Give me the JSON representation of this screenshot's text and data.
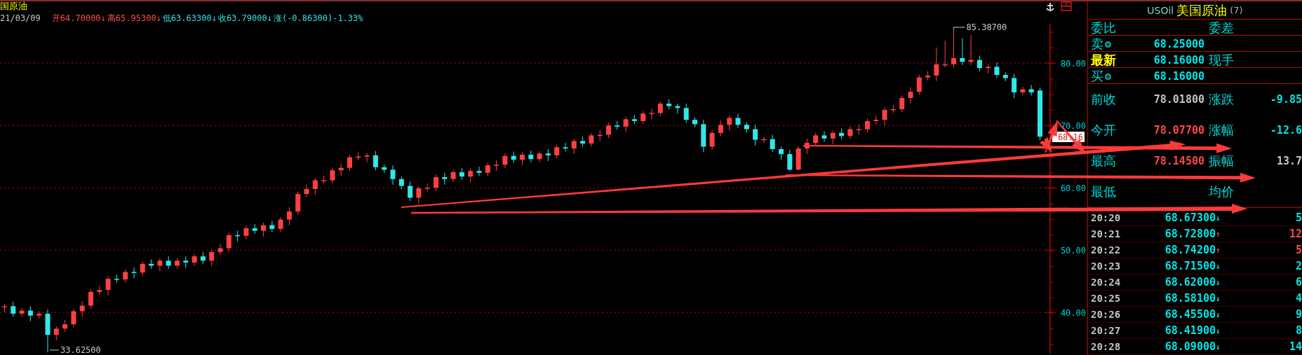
{
  "chart": {
    "title": "国原油",
    "date": "21/03/09",
    "quote": [
      {
        "text": "开64.70000↓",
        "color": "#ff4d4d"
      },
      {
        "text": "高65.95300↓",
        "color": "#ff4d4d"
      },
      {
        "text": "低63.63300↓",
        "color": "#33e0e0"
      },
      {
        "text": "收63.79000↓",
        "color": "#33e0e0"
      },
      {
        "text": "涨(-0.86300)-1.33%",
        "color": "#33e0e0"
      }
    ],
    "high_label": "85.38700",
    "low_label": "33.62500",
    "price_tag": "68.16",
    "chart_data": {
      "type": "candlestick",
      "grid": true,
      "ylim": [
        33.4,
        86.3
      ],
      "ohlc": [
        [
          40.9,
          41.4,
          40.0,
          41.0
        ],
        [
          41.0,
          41.7,
          39.3,
          39.8
        ],
        [
          39.8,
          40.7,
          39.3,
          40.3
        ],
        [
          40.3,
          41.0,
          38.6,
          39.5
        ],
        [
          39.5,
          40.2,
          39.0,
          39.8
        ],
        [
          39.8,
          40.5,
          33.6,
          36.4
        ],
        [
          36.4,
          37.8,
          35.5,
          37.4
        ],
        [
          37.4,
          38.8,
          36.9,
          38.1
        ],
        [
          38.1,
          40.6,
          37.6,
          40.2
        ],
        [
          40.2,
          41.8,
          39.3,
          41.1
        ],
        [
          41.1,
          43.7,
          40.6,
          43.3
        ],
        [
          43.3,
          44.3,
          42.8,
          43.6
        ],
        [
          43.6,
          45.8,
          42.7,
          45.4
        ],
        [
          45.4,
          46.1,
          44.8,
          45.3
        ],
        [
          45.3,
          46.9,
          44.8,
          46.5
        ],
        [
          46.5,
          47.2,
          45.5,
          46.4
        ],
        [
          46.4,
          48.2,
          45.9,
          47.8
        ],
        [
          47.8,
          48.5,
          47.0,
          47.5
        ],
        [
          47.5,
          48.7,
          46.6,
          48.3
        ],
        [
          48.3,
          49.0,
          47.0,
          47.5
        ],
        [
          47.5,
          48.7,
          47.0,
          48.3
        ],
        [
          48.3,
          49.0,
          47.1,
          48.0
        ],
        [
          48.0,
          49.4,
          47.5,
          49.0
        ],
        [
          49.0,
          49.7,
          47.8,
          48.3
        ],
        [
          48.3,
          50.1,
          47.4,
          49.7
        ],
        [
          49.7,
          51.0,
          49.2,
          50.3
        ],
        [
          50.3,
          52.8,
          49.8,
          52.4
        ],
        [
          52.4,
          53.1,
          51.4,
          52.3
        ],
        [
          52.3,
          53.9,
          51.8,
          53.5
        ],
        [
          53.5,
          54.2,
          52.6,
          53.1
        ],
        [
          53.1,
          54.4,
          52.2,
          54.0
        ],
        [
          54.0,
          54.7,
          52.9,
          53.4
        ],
        [
          53.4,
          55.3,
          52.9,
          54.9
        ],
        [
          54.9,
          56.9,
          54.0,
          56.2
        ],
        [
          56.2,
          59.4,
          55.7,
          59.0
        ],
        [
          59.0,
          60.5,
          58.5,
          59.8
        ],
        [
          59.8,
          61.6,
          58.9,
          61.2
        ],
        [
          61.2,
          61.9,
          60.7,
          61.2
        ],
        [
          61.2,
          63.2,
          60.7,
          62.8
        ],
        [
          62.8,
          63.9,
          61.9,
          63.2
        ],
        [
          63.2,
          65.3,
          62.7,
          64.9
        ],
        [
          64.9,
          65.7,
          64.4,
          65.0
        ],
        [
          65.0,
          65.6,
          64.1,
          65.2
        ],
        [
          65.2,
          65.9,
          62.8,
          63.3
        ],
        [
          63.3,
          63.7,
          62.4,
          62.9
        ],
        [
          62.9,
          63.6,
          60.5,
          61.4
        ],
        [
          61.4,
          61.8,
          59.8,
          60.3
        ],
        [
          60.3,
          61.0,
          57.9,
          58.4
        ],
        [
          58.4,
          60.3,
          57.5,
          59.9
        ],
        [
          59.9,
          60.7,
          59.4,
          60.0
        ],
        [
          60.0,
          62.1,
          59.5,
          61.7
        ],
        [
          61.7,
          62.4,
          60.5,
          61.4
        ],
        [
          61.4,
          62.9,
          60.9,
          62.5
        ],
        [
          62.5,
          63.2,
          61.3,
          61.8
        ],
        [
          61.8,
          63.1,
          60.9,
          62.7
        ],
        [
          62.7,
          63.4,
          61.9,
          62.4
        ],
        [
          62.4,
          64.0,
          61.9,
          63.6
        ],
        [
          63.6,
          64.4,
          62.7,
          63.7
        ],
        [
          63.7,
          65.5,
          63.2,
          65.1
        ],
        [
          65.1,
          65.8,
          64.0,
          64.5
        ],
        [
          64.5,
          65.7,
          63.6,
          65.3
        ],
        [
          65.3,
          66.0,
          64.1,
          64.6
        ],
        [
          64.6,
          65.9,
          64.1,
          65.5
        ],
        [
          65.5,
          66.2,
          64.3,
          65.2
        ],
        [
          65.2,
          66.9,
          64.7,
          66.5
        ],
        [
          66.5,
          67.2,
          65.8,
          66.3
        ],
        [
          66.3,
          67.9,
          65.4,
          67.5
        ],
        [
          67.5,
          68.2,
          66.6,
          67.1
        ],
        [
          67.1,
          68.8,
          66.6,
          68.4
        ],
        [
          68.4,
          69.2,
          67.5,
          68.5
        ],
        [
          68.5,
          70.4,
          68.0,
          70.0
        ],
        [
          70.0,
          70.7,
          69.3,
          69.8
        ],
        [
          69.8,
          71.4,
          68.9,
          71.0
        ],
        [
          71.0,
          71.7,
          70.2,
          70.7
        ],
        [
          70.7,
          72.3,
          70.2,
          71.9
        ],
        [
          71.9,
          72.7,
          71.0,
          72.0
        ],
        [
          72.0,
          73.9,
          71.5,
          73.5
        ],
        [
          73.5,
          74.2,
          72.6,
          73.1
        ],
        [
          73.1,
          73.5,
          71.9,
          72.8
        ],
        [
          72.8,
          73.5,
          70.4,
          70.9
        ],
        [
          70.9,
          71.3,
          69.7,
          70.2
        ],
        [
          70.2,
          70.9,
          65.7,
          66.6
        ],
        [
          66.6,
          69.2,
          66.1,
          68.8
        ],
        [
          68.8,
          70.8,
          68.3,
          70.1
        ],
        [
          70.1,
          71.6,
          69.2,
          71.2
        ],
        [
          71.2,
          71.9,
          69.6,
          70.1
        ],
        [
          70.1,
          70.5,
          68.9,
          69.4
        ],
        [
          69.4,
          70.1,
          66.8,
          67.7
        ],
        [
          67.7,
          68.2,
          67.2,
          67.8
        ],
        [
          67.8,
          68.5,
          65.7,
          66.2
        ],
        [
          66.2,
          66.6,
          64.5,
          65.4
        ],
        [
          65.4,
          66.1,
          62.8,
          62.9
        ],
        [
          62.9,
          66.7,
          62.8,
          66.3
        ],
        [
          66.3,
          67.9,
          65.4,
          67.2
        ],
        [
          67.2,
          68.8,
          66.7,
          68.4
        ],
        [
          68.4,
          69.1,
          67.4,
          67.9
        ],
        [
          67.9,
          69.2,
          67.0,
          68.8
        ],
        [
          68.8,
          69.5,
          67.8,
          68.3
        ],
        [
          68.3,
          69.8,
          67.8,
          69.4
        ],
        [
          69.4,
          70.1,
          68.5,
          69.4
        ],
        [
          69.4,
          71.1,
          68.9,
          70.7
        ],
        [
          70.7,
          71.6,
          70.2,
          70.9
        ],
        [
          70.9,
          72.9,
          70.0,
          72.5
        ],
        [
          72.5,
          73.3,
          72.0,
          72.6
        ],
        [
          72.6,
          74.8,
          72.1,
          74.4
        ],
        [
          74.4,
          76.1,
          73.5,
          75.4
        ],
        [
          75.4,
          78.1,
          74.9,
          77.7
        ],
        [
          77.7,
          78.7,
          77.2,
          78.0
        ],
        [
          78.0,
          82.5,
          77.1,
          79.8
        ],
        [
          79.8,
          83.6,
          79.3,
          79.8
        ],
        [
          79.8,
          85.4,
          79.3,
          80.8
        ],
        [
          80.8,
          84.0,
          79.7,
          80.2
        ],
        [
          80.2,
          84.5,
          79.7,
          80.5
        ],
        [
          80.5,
          81.2,
          78.7,
          79.2
        ],
        [
          79.2,
          79.8,
          78.3,
          79.4
        ],
        [
          79.4,
          80.1,
          77.6,
          78.1
        ],
        [
          78.1,
          78.5,
          77.1,
          77.6
        ],
        [
          77.6,
          78.3,
          74.4,
          75.3
        ],
        [
          75.3,
          76.2,
          74.8,
          75.8
        ],
        [
          75.8,
          76.5,
          74.8,
          75.3
        ],
        [
          75.6,
          76.0,
          67.6,
          68.2
        ]
      ],
      "yticks": [
        {
          "value": 80,
          "label": "80.00"
        },
        {
          "value": 70,
          "label": "70.00"
        },
        {
          "value": 60,
          "label": "60.00"
        },
        {
          "value": 50,
          "label": "50.00"
        },
        {
          "value": 40,
          "label": "40.00"
        }
      ]
    }
  },
  "panel": {
    "symbol": "USOil",
    "name": "美国原油",
    "count": "(7)",
    "order_rows": [
      {
        "kind": "header",
        "label": "委比",
        "label2": "委差"
      },
      {
        "kind": "ask",
        "label": "卖",
        "value": "68.25000"
      },
      {
        "kind": "latest",
        "label": "最新",
        "value": "68.16000",
        "label2": "现手"
      },
      {
        "kind": "bid",
        "label": "买",
        "value": "68.16000"
      }
    ],
    "stats": [
      {
        "label": "前收",
        "value": {
          "text": "78.01800",
          "color": "#c4c4c4"
        },
        "label2": "涨跌",
        "value2": {
          "text": "-9.85",
          "color": "#00e5e5"
        }
      },
      {
        "label": "今开",
        "value": {
          "text": "78.07700",
          "color": "#ff4848"
        },
        "label2": "涨幅",
        "value2": {
          "text": "-12.6",
          "color": "#00e5e5"
        }
      },
      {
        "label": "最高",
        "value": {
          "text": "78.14500",
          "color": "#ff4848"
        },
        "label2": "振幅",
        "value2": {
          "text": "13.7",
          "color": "#c4c4c4"
        }
      },
      {
        "label": "最低",
        "label2": "均价"
      }
    ],
    "ticks": [
      {
        "time": "20:20",
        "price": "68.67300",
        "arrow": "↓",
        "color": "#00e5e5",
        "volume": "5"
      },
      {
        "time": "20:21",
        "price": "68.72800",
        "arrow": "↑",
        "color": "#ff4848",
        "volume": "12"
      },
      {
        "time": "20:22",
        "price": "68.74200",
        "arrow": "↑",
        "color": "#ff4848",
        "volume": "5"
      },
      {
        "time": "20:23",
        "price": "68.71500",
        "arrow": "↓",
        "color": "#00e5e5",
        "volume": "2"
      },
      {
        "time": "20:24",
        "price": "68.62000",
        "arrow": "↓",
        "color": "#00e5e5",
        "volume": "6"
      },
      {
        "time": "20:25",
        "price": "68.58100",
        "arrow": "↓",
        "color": "#00e5e5",
        "volume": "4"
      },
      {
        "time": "20:26",
        "price": "68.45500",
        "arrow": "↓",
        "color": "#00e5e5",
        "volume": "9"
      },
      {
        "time": "20:27",
        "price": "68.41900",
        "arrow": "↓",
        "color": "#00e5e5",
        "volume": "8"
      },
      {
        "time": "20:28",
        "price": "68.09000",
        "arrow": "↓",
        "color": "#00e5e5",
        "volume": "14"
      }
    ]
  }
}
